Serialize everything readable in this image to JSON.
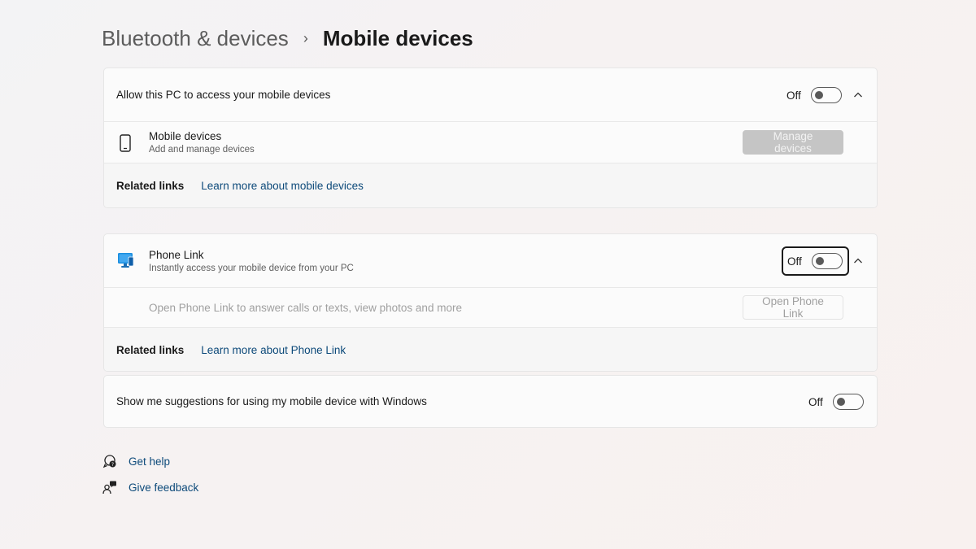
{
  "breadcrumb": {
    "parent": "Bluetooth & devices",
    "separator": "›",
    "current": "Mobile devices"
  },
  "allow_card": {
    "header_label": "Allow this PC to access your mobile devices",
    "toggle_state": "Off",
    "mobile_devices_title": "Mobile devices",
    "mobile_devices_sub": "Add and manage devices",
    "manage_button": "Manage devices",
    "related_label": "Related links",
    "related_link": "Learn more about mobile devices"
  },
  "phone_card": {
    "title": "Phone Link",
    "sub": "Instantly access your mobile device from your PC",
    "toggle_state": "Off",
    "open_text": "Open Phone Link to answer calls or texts, view photos and more",
    "open_button": "Open Phone Link",
    "related_label": "Related links",
    "related_link": "Learn more about Phone Link"
  },
  "suggestions_card": {
    "label": "Show me suggestions for using my mobile device with Windows",
    "toggle_state": "Off"
  },
  "footer": {
    "help": "Get help",
    "feedback": "Give feedback"
  },
  "colors": {
    "link": "#0d4a7a",
    "phone_link_icon": "#1b8fe0"
  }
}
